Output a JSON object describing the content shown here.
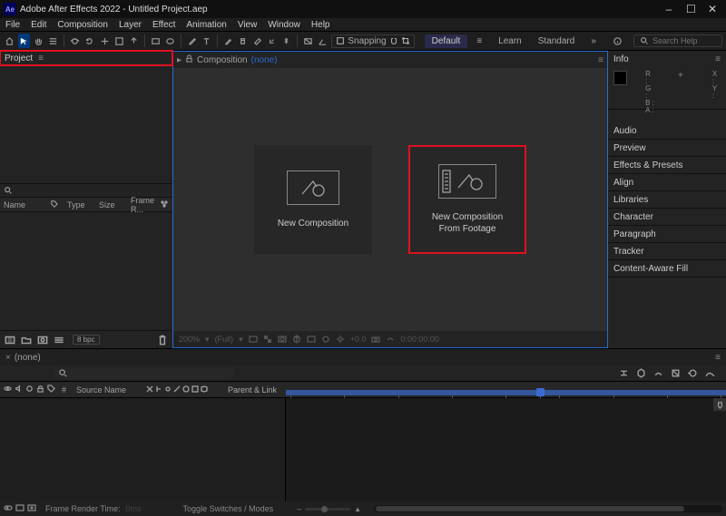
{
  "titlebar": {
    "app": "Ae",
    "title": "Adobe After Effects 2022 - Untitled Project.aep"
  },
  "menu": [
    "File",
    "Edit",
    "Composition",
    "Layer",
    "Effect",
    "Animation",
    "View",
    "Window",
    "Help"
  ],
  "toolbar": {
    "snapping": "Snapping"
  },
  "workspaces": {
    "active": "Default",
    "items": [
      "Default",
      "Learn",
      "Standard"
    ]
  },
  "search": {
    "placeholder": "Search Help"
  },
  "project": {
    "tab": "Project",
    "cols": {
      "name": "Name",
      "type": "Type",
      "size": "Size",
      "frame": "Frame R..."
    },
    "bpc": "8 bpc"
  },
  "viewer": {
    "tab": "Composition",
    "none": "(none)",
    "btn1": "New Composition",
    "btn2a": "New Composition",
    "btn2b": "From Footage",
    "zoom": "200%",
    "time": "0;00;00",
    "dur": "+0.0",
    "tc": "0:00:00:00"
  },
  "right": {
    "info": "Info",
    "rgba": [
      "R :",
      "G :",
      "B :",
      "A :"
    ],
    "xy": [
      "X :",
      "Y :"
    ],
    "panels": [
      "Audio",
      "Preview",
      "Effects & Presets",
      "Align",
      "Libraries",
      "Character",
      "Paragraph",
      "Tracker",
      "Content-Aware Fill"
    ]
  },
  "timeline": {
    "tab": "(none)",
    "source": "Source Name",
    "parent": "Parent & Link",
    "frt_label": "Frame Render Time:",
    "frt_val": "0ms",
    "toggle": "Toggle Switches / Modes"
  }
}
